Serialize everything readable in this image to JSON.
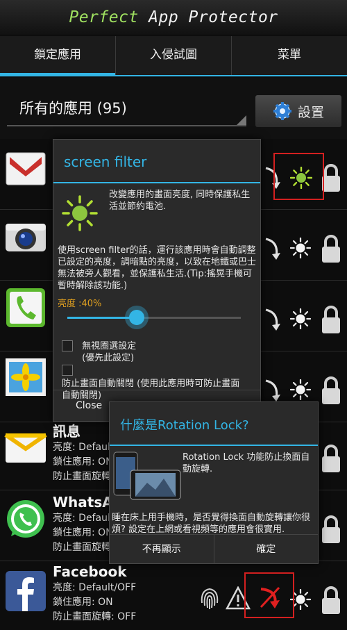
{
  "app_title_part1": "Perfect",
  "app_title_part2": "App Protector",
  "tabs": [
    {
      "label": "鎖定應用",
      "active": true
    },
    {
      "label": "入侵試圖",
      "active": false
    },
    {
      "label": "菜單",
      "active": false
    }
  ],
  "filter": {
    "selected": "所有的應用 (95)"
  },
  "settings_label": "設置",
  "apps": [
    {
      "name": "訊息",
      "brightness": "亮度: Default/OFF",
      "lock_app": "鎖住應用: ON",
      "screen_off": "防止畫面旋轉: OFF",
      "icon": "messages-icon"
    },
    {
      "name": "WhatsApp",
      "brightness": "亮度: Default/OFF",
      "lock_app": "鎖住應用: ON",
      "screen_off": "防止畫面旋轉: OFF",
      "icon": "whatsapp-icon"
    },
    {
      "name": "Facebook",
      "brightness": "亮度: Default/OFF",
      "lock_app": "鎖住應用: ON",
      "screen_off": "防止畫面旋轉: OFF",
      "icon": "facebook-icon"
    }
  ],
  "screen_filter_dialog": {
    "title": "screen filter",
    "intro": "改變應用的畫面亮度, 同時保護私生活並節約電池.",
    "body": "使用screen filter的話，運行該應用時會自動調整已設定的亮度，調暗點的亮度，以致在地鐵或巴士無法被旁人觀看，並保護私生活.(Tip:搖晃手機可暫時解除該功能.)",
    "brightness_label": "亮度 :40%",
    "brightness_value": 0.4,
    "option1": "無視圈選設定\n(優先此設定)",
    "option2": "防止畫面自動關閉 (使用此應用時可防止畫面自動關閉)",
    "close_label": "Close"
  },
  "rotation_dialog": {
    "title": "什麼是Rotation Lock?",
    "intro": "Rotation Lock 功能防止換面自動旋轉.",
    "body": "睡在床上用手機時，是否覺得換面自動旋轉讓你很煩? 設定在上網或看視頻等的應用會很實用.",
    "dont_show_label": "不再顯示",
    "ok_label": "確定"
  },
  "colors": {
    "accent": "#33b5e5",
    "highlight_red": "#d42020",
    "title_green": "#9fe060"
  }
}
